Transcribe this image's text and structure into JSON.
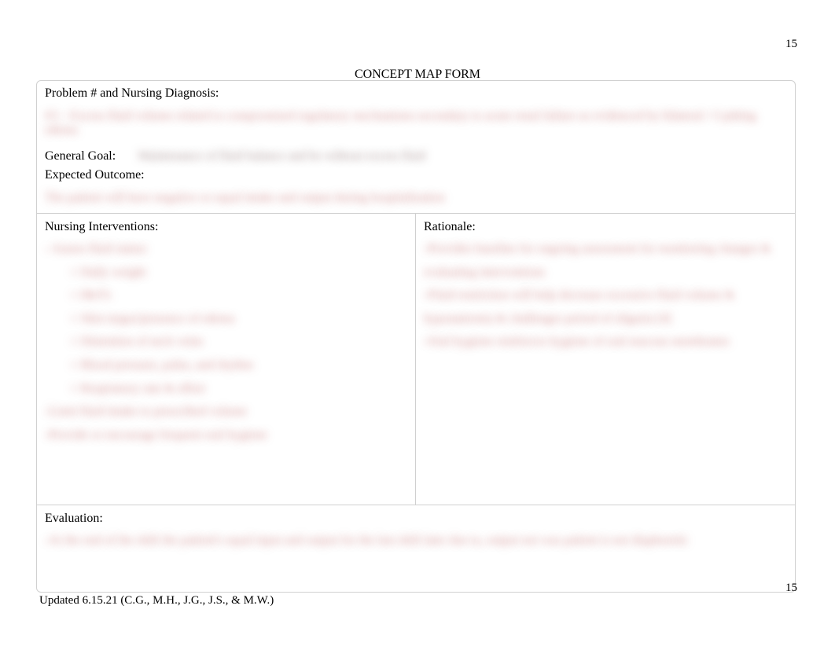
{
  "page": {
    "number_top": "15",
    "number_bottom": "15",
    "footer": "Updated 6.15.21 (C.G., M.H., J.G., J.S., & M.W.)",
    "title": "CONCEPT MAP FORM"
  },
  "form": {
    "problem_label": "Problem # and Nursing Diagnosis:",
    "problem_value": "#3 – Excess fluid volume related to compromised regulatory mechanisms secondary to acute renal failure as evidenced by bilateral +3 pitting edema",
    "goal_label": "General Goal:",
    "goal_value": "Maintenance of fluid balance and be without excess fluid",
    "expected_label": "Expected Outcome:",
    "expected_value": "The patient will have negative or equal intake and output during hospitalization",
    "interventions_label": "Nursing Interventions:",
    "interventions": {
      "main1": "- Assess fluid status:",
      "sub1": "○ Daily weight",
      "sub2": "○ I&O's",
      "sub3": "○ Skin turgor/presence of edema",
      "sub4": "○ Distention of neck veins",
      "sub5": "○ Blood pressure, pulse, and rhythm",
      "sub6": "○ Respiratory rate & effort",
      "main2": "-Limit fluid intake to prescribed volume",
      "main3": "-Provide or encourage frequent oral hygiene"
    },
    "rationale_label": "Rationale:",
    "rationale": {
      "line1": "-Provides baseline for ongoing assessment for monitoring changes & evaluating interventions",
      "line2": "-Fluid restriction will help decrease excessive fluid volume & hyponatremia & challenges period of oliguria [4]",
      "line3": "-Oral hygiene reinforces hygiene of oral mucous membranes"
    },
    "evaluation_label": "Evaluation:",
    "evaluation_value": "-At the end of the shift the patient's equal input and output for the last shift later due to, output not was patient is not diaphoretic"
  }
}
